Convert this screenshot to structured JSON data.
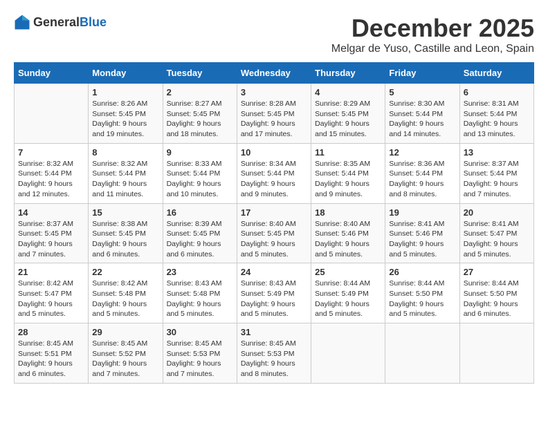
{
  "logo": {
    "general": "General",
    "blue": "Blue"
  },
  "header": {
    "month_year": "December 2025",
    "location": "Melgar de Yuso, Castille and Leon, Spain"
  },
  "weekdays": [
    "Sunday",
    "Monday",
    "Tuesday",
    "Wednesday",
    "Thursday",
    "Friday",
    "Saturday"
  ],
  "weeks": [
    [
      {
        "day": "",
        "sunrise": "",
        "sunset": "",
        "daylight": ""
      },
      {
        "day": "1",
        "sunrise": "Sunrise: 8:26 AM",
        "sunset": "Sunset: 5:45 PM",
        "daylight": "Daylight: 9 hours and 19 minutes."
      },
      {
        "day": "2",
        "sunrise": "Sunrise: 8:27 AM",
        "sunset": "Sunset: 5:45 PM",
        "daylight": "Daylight: 9 hours and 18 minutes."
      },
      {
        "day": "3",
        "sunrise": "Sunrise: 8:28 AM",
        "sunset": "Sunset: 5:45 PM",
        "daylight": "Daylight: 9 hours and 17 minutes."
      },
      {
        "day": "4",
        "sunrise": "Sunrise: 8:29 AM",
        "sunset": "Sunset: 5:45 PM",
        "daylight": "Daylight: 9 hours and 15 minutes."
      },
      {
        "day": "5",
        "sunrise": "Sunrise: 8:30 AM",
        "sunset": "Sunset: 5:44 PM",
        "daylight": "Daylight: 9 hours and 14 minutes."
      },
      {
        "day": "6",
        "sunrise": "Sunrise: 8:31 AM",
        "sunset": "Sunset: 5:44 PM",
        "daylight": "Daylight: 9 hours and 13 minutes."
      }
    ],
    [
      {
        "day": "7",
        "sunrise": "Sunrise: 8:32 AM",
        "sunset": "Sunset: 5:44 PM",
        "daylight": "Daylight: 9 hours and 12 minutes."
      },
      {
        "day": "8",
        "sunrise": "Sunrise: 8:32 AM",
        "sunset": "Sunset: 5:44 PM",
        "daylight": "Daylight: 9 hours and 11 minutes."
      },
      {
        "day": "9",
        "sunrise": "Sunrise: 8:33 AM",
        "sunset": "Sunset: 5:44 PM",
        "daylight": "Daylight: 9 hours and 10 minutes."
      },
      {
        "day": "10",
        "sunrise": "Sunrise: 8:34 AM",
        "sunset": "Sunset: 5:44 PM",
        "daylight": "Daylight: 9 hours and 9 minutes."
      },
      {
        "day": "11",
        "sunrise": "Sunrise: 8:35 AM",
        "sunset": "Sunset: 5:44 PM",
        "daylight": "Daylight: 9 hours and 9 minutes."
      },
      {
        "day": "12",
        "sunrise": "Sunrise: 8:36 AM",
        "sunset": "Sunset: 5:44 PM",
        "daylight": "Daylight: 9 hours and 8 minutes."
      },
      {
        "day": "13",
        "sunrise": "Sunrise: 8:37 AM",
        "sunset": "Sunset: 5:44 PM",
        "daylight": "Daylight: 9 hours and 7 minutes."
      }
    ],
    [
      {
        "day": "14",
        "sunrise": "Sunrise: 8:37 AM",
        "sunset": "Sunset: 5:45 PM",
        "daylight": "Daylight: 9 hours and 7 minutes."
      },
      {
        "day": "15",
        "sunrise": "Sunrise: 8:38 AM",
        "sunset": "Sunset: 5:45 PM",
        "daylight": "Daylight: 9 hours and 6 minutes."
      },
      {
        "day": "16",
        "sunrise": "Sunrise: 8:39 AM",
        "sunset": "Sunset: 5:45 PM",
        "daylight": "Daylight: 9 hours and 6 minutes."
      },
      {
        "day": "17",
        "sunrise": "Sunrise: 8:40 AM",
        "sunset": "Sunset: 5:45 PM",
        "daylight": "Daylight: 9 hours and 5 minutes."
      },
      {
        "day": "18",
        "sunrise": "Sunrise: 8:40 AM",
        "sunset": "Sunset: 5:46 PM",
        "daylight": "Daylight: 9 hours and 5 minutes."
      },
      {
        "day": "19",
        "sunrise": "Sunrise: 8:41 AM",
        "sunset": "Sunset: 5:46 PM",
        "daylight": "Daylight: 9 hours and 5 minutes."
      },
      {
        "day": "20",
        "sunrise": "Sunrise: 8:41 AM",
        "sunset": "Sunset: 5:47 PM",
        "daylight": "Daylight: 9 hours and 5 minutes."
      }
    ],
    [
      {
        "day": "21",
        "sunrise": "Sunrise: 8:42 AM",
        "sunset": "Sunset: 5:47 PM",
        "daylight": "Daylight: 9 hours and 5 minutes."
      },
      {
        "day": "22",
        "sunrise": "Sunrise: 8:42 AM",
        "sunset": "Sunset: 5:48 PM",
        "daylight": "Daylight: 9 hours and 5 minutes."
      },
      {
        "day": "23",
        "sunrise": "Sunrise: 8:43 AM",
        "sunset": "Sunset: 5:48 PM",
        "daylight": "Daylight: 9 hours and 5 minutes."
      },
      {
        "day": "24",
        "sunrise": "Sunrise: 8:43 AM",
        "sunset": "Sunset: 5:49 PM",
        "daylight": "Daylight: 9 hours and 5 minutes."
      },
      {
        "day": "25",
        "sunrise": "Sunrise: 8:44 AM",
        "sunset": "Sunset: 5:49 PM",
        "daylight": "Daylight: 9 hours and 5 minutes."
      },
      {
        "day": "26",
        "sunrise": "Sunrise: 8:44 AM",
        "sunset": "Sunset: 5:50 PM",
        "daylight": "Daylight: 9 hours and 5 minutes."
      },
      {
        "day": "27",
        "sunrise": "Sunrise: 8:44 AM",
        "sunset": "Sunset: 5:50 PM",
        "daylight": "Daylight: 9 hours and 6 minutes."
      }
    ],
    [
      {
        "day": "28",
        "sunrise": "Sunrise: 8:45 AM",
        "sunset": "Sunset: 5:51 PM",
        "daylight": "Daylight: 9 hours and 6 minutes."
      },
      {
        "day": "29",
        "sunrise": "Sunrise: 8:45 AM",
        "sunset": "Sunset: 5:52 PM",
        "daylight": "Daylight: 9 hours and 7 minutes."
      },
      {
        "day": "30",
        "sunrise": "Sunrise: 8:45 AM",
        "sunset": "Sunset: 5:53 PM",
        "daylight": "Daylight: 9 hours and 7 minutes."
      },
      {
        "day": "31",
        "sunrise": "Sunrise: 8:45 AM",
        "sunset": "Sunset: 5:53 PM",
        "daylight": "Daylight: 9 hours and 8 minutes."
      },
      {
        "day": "",
        "sunrise": "",
        "sunset": "",
        "daylight": ""
      },
      {
        "day": "",
        "sunrise": "",
        "sunset": "",
        "daylight": ""
      },
      {
        "day": "",
        "sunrise": "",
        "sunset": "",
        "daylight": ""
      }
    ]
  ]
}
